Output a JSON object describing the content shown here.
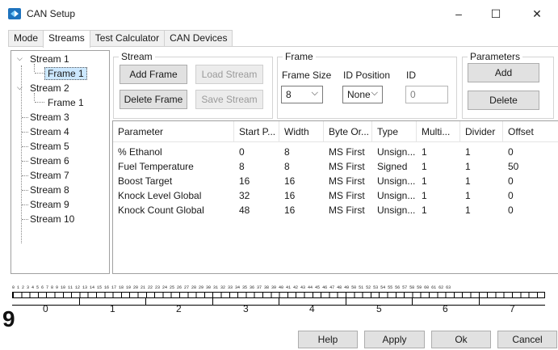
{
  "window": {
    "title": "CAN Setup",
    "minimize": "–",
    "maximize": "☐",
    "close": "✕"
  },
  "tabs": [
    "Mode",
    "Streams",
    "Test Calculator",
    "CAN Devices"
  ],
  "active_tab": "Streams",
  "tree": {
    "streams": [
      {
        "label": "Stream 1",
        "expanded": true,
        "children": [
          "Frame 1"
        ]
      },
      {
        "label": "Stream 2",
        "expanded": true,
        "children": [
          "Frame 1"
        ]
      },
      {
        "label": "Stream 3"
      },
      {
        "label": "Stream 4"
      },
      {
        "label": "Stream 5"
      },
      {
        "label": "Stream 6"
      },
      {
        "label": "Stream 7"
      },
      {
        "label": "Stream 8"
      },
      {
        "label": "Stream 9"
      },
      {
        "label": "Stream 10"
      }
    ],
    "selected": "Stream 1 / Frame 1"
  },
  "stream_group": {
    "title": "Stream",
    "add_frame": "Add Frame",
    "load_stream": "Load Stream",
    "delete_frame": "Delete Frame",
    "save_stream": "Save Stream"
  },
  "frame_group": {
    "title": "Frame",
    "frame_size_label": "Frame Size",
    "frame_size_value": "8",
    "id_position_label": "ID Position",
    "id_position_value": "None",
    "id_label": "ID",
    "id_value": "0"
  },
  "parameters_group": {
    "title": "Parameters",
    "add": "Add",
    "delete": "Delete"
  },
  "table": {
    "columns": [
      "Parameter",
      "Start P...",
      "Width",
      "Byte Or...",
      "Type",
      "Multi...",
      "Divider",
      "Offset"
    ],
    "rows": [
      [
        "% Ethanol",
        "0",
        "8",
        "MS First",
        "Unsign...",
        "1",
        "1",
        "0"
      ],
      [
        "Fuel Temperature",
        "8",
        "8",
        "MS First",
        "Signed",
        "1",
        "1",
        "50"
      ],
      [
        "Boost Target",
        "16",
        "16",
        "MS First",
        "Unsign...",
        "1",
        "1",
        "0"
      ],
      [
        "Knock Level  Global",
        "32",
        "16",
        "MS First",
        "Unsign...",
        "1",
        "1",
        "0"
      ],
      [
        "Knock Count Global",
        "48",
        "16",
        "MS First",
        "Unsign...",
        "1",
        "1",
        "0"
      ]
    ]
  },
  "bit_ruler": {
    "bit_numbers": "0 1 2 3 4 5 6 7 8 9 10 11 12 13 14 15 16 17 18 19 20 21 22 23 24 25 26 27 28 29 30 31 32 33 34 35 36 37 38 39 40 41 42 43 44 45 46 47 48 49 50 51 52 53 54 55 56 57 58 59 60 61 62 63",
    "bytes": [
      "0",
      "1",
      "2",
      "3",
      "4",
      "5",
      "6",
      "7"
    ]
  },
  "marker": "9",
  "footer": {
    "help": "Help",
    "apply": "Apply",
    "ok": "Ok",
    "cancel": "Cancel"
  },
  "colors": {
    "selection": "#cce8ff",
    "button_face": "#e1e1e1",
    "disabled_text": "#9a9a9a"
  }
}
